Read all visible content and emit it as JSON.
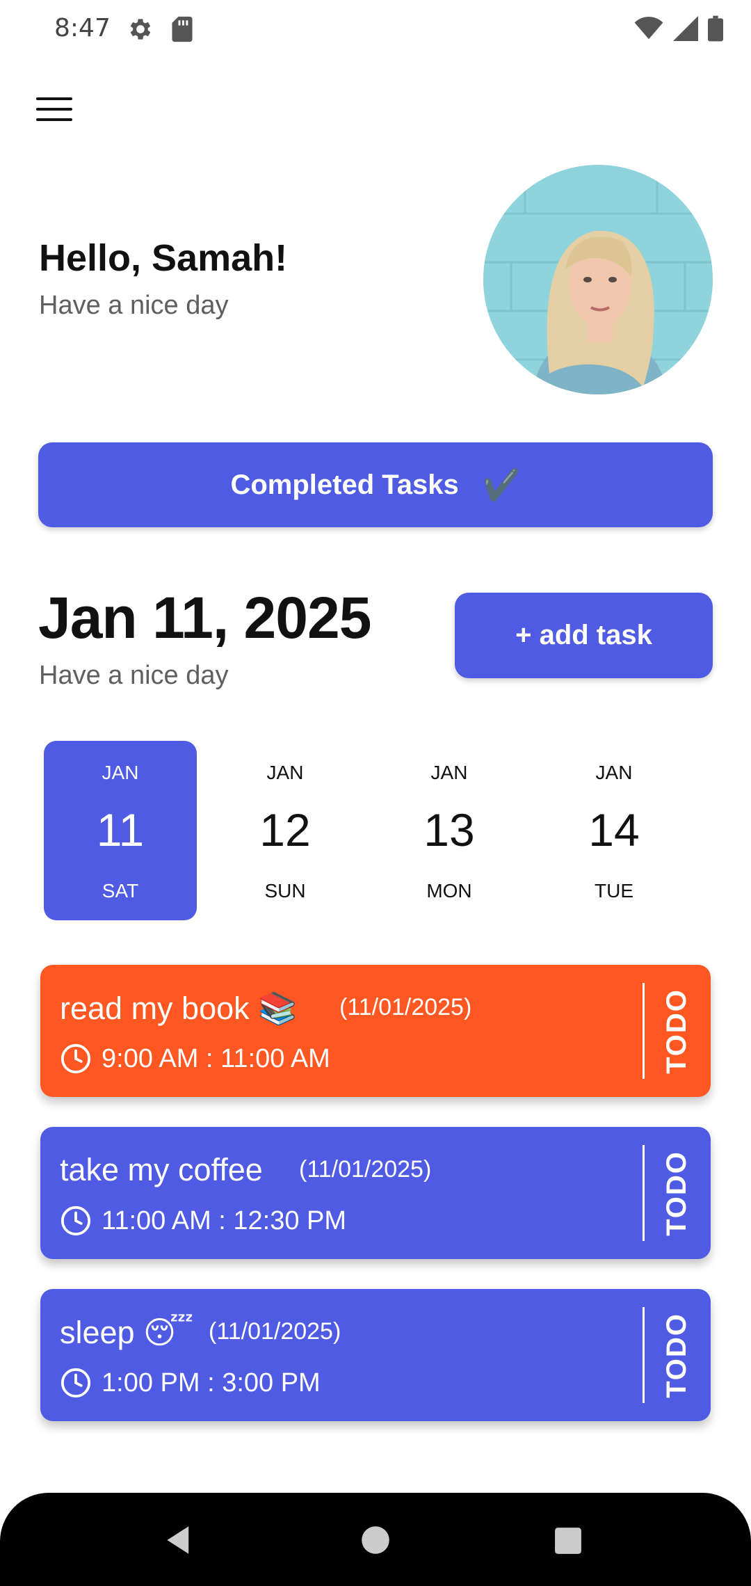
{
  "status_bar": {
    "time": "8:47",
    "left_icons": [
      "gear-icon",
      "sd-card-icon"
    ],
    "right_icons": [
      "wifi-icon",
      "signal-icon",
      "battery-icon"
    ]
  },
  "header": {
    "menu_icon": "hamburger-menu-icon"
  },
  "greeting": {
    "title": "Hello, Samah!",
    "subtitle": "Have a nice day"
  },
  "completed_button": {
    "label": "Completed Tasks",
    "icon": "✔️"
  },
  "date_header": {
    "date": "Jan 11, 2025",
    "subtitle": "Have a nice day",
    "add_task_label": "+ add task"
  },
  "calendar": {
    "days": [
      {
        "month": "JAN",
        "day": "11",
        "weekday": "SAT",
        "selected": true
      },
      {
        "month": "JAN",
        "day": "12",
        "weekday": "SUN",
        "selected": false
      },
      {
        "month": "JAN",
        "day": "13",
        "weekday": "MON",
        "selected": false
      },
      {
        "month": "JAN",
        "day": "14",
        "weekday": "TUE",
        "selected": false
      }
    ]
  },
  "tasks": [
    {
      "title": "read my book 📚",
      "date": "(11/01/2025)",
      "time": "9:00 AM : 11:00 AM",
      "status": "TODO",
      "color": "#ff5722"
    },
    {
      "title": "take my coffee",
      "date": "(11/01/2025)",
      "time": "11:00 AM : 12:30 PM",
      "status": "TODO",
      "color": "#4f5be3"
    },
    {
      "title": "sleep 😴",
      "date": "(11/01/2025)",
      "time": "1:00 PM : 3:00 PM",
      "status": "TODO",
      "color": "#4f5be3"
    }
  ],
  "colors": {
    "primary": "#4f5be3",
    "accent_orange": "#ff5722"
  },
  "nav_bar": {
    "icons": [
      "back-icon",
      "home-icon",
      "recents-icon"
    ]
  }
}
